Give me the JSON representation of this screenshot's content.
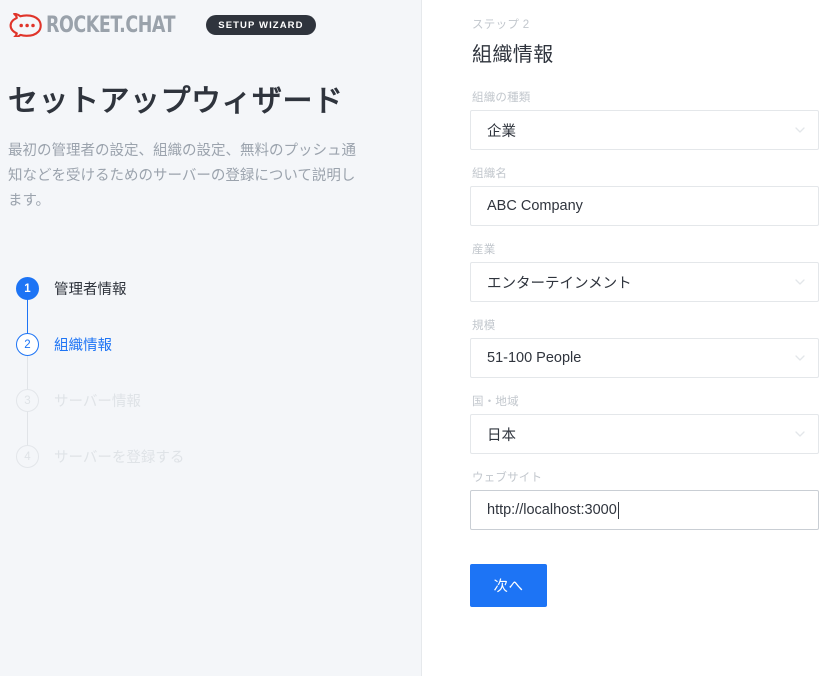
{
  "brand": {
    "logo_icon": "rocket-chat-logo-icon",
    "wordmark": "ROCKET.CHAT",
    "badge": "SETUP WIZARD",
    "badge_bg": "#2f343d",
    "logo_color": "#e0342a"
  },
  "left": {
    "title": "セットアップウィザード",
    "description": "最初の管理者の設定、組織の設定、無料のプッシュ通知などを受けるためのサーバーの登録について説明します。",
    "steps": [
      {
        "number": "1",
        "label": "管理者情報",
        "state": "done"
      },
      {
        "number": "2",
        "label": "組織情報",
        "state": "active"
      },
      {
        "number": "3",
        "label": "サーバー情報",
        "state": "todo"
      },
      {
        "number": "4",
        "label": "サーバーを登録する",
        "state": "todo"
      }
    ],
    "accent_color": "#1d74f5",
    "background": "#f4f6f9"
  },
  "right": {
    "eyebrow": "ステップ 2",
    "title": "組織情報",
    "fields": [
      {
        "label": "組織の種類",
        "value": "企業",
        "type": "select",
        "icon": "chevron-down-icon",
        "name": "organization-type"
      },
      {
        "label": "組織名",
        "value": "ABC Company",
        "type": "text",
        "name": "organization-name"
      },
      {
        "label": "産業",
        "value": "エンターテインメント",
        "type": "select",
        "icon": "chevron-down-icon",
        "name": "industry"
      },
      {
        "label": "規模",
        "value": "51-100 People",
        "type": "select",
        "icon": "chevron-down-icon",
        "name": "organization-size"
      },
      {
        "label": "国・地域",
        "value": "日本",
        "type": "select",
        "icon": "chevron-down-icon",
        "name": "country"
      },
      {
        "label": "ウェブサイト",
        "value": "http://localhost:3000",
        "type": "text",
        "focused": true,
        "name": "website"
      }
    ],
    "next_label": "次へ",
    "button_color": "#1d74f5"
  }
}
